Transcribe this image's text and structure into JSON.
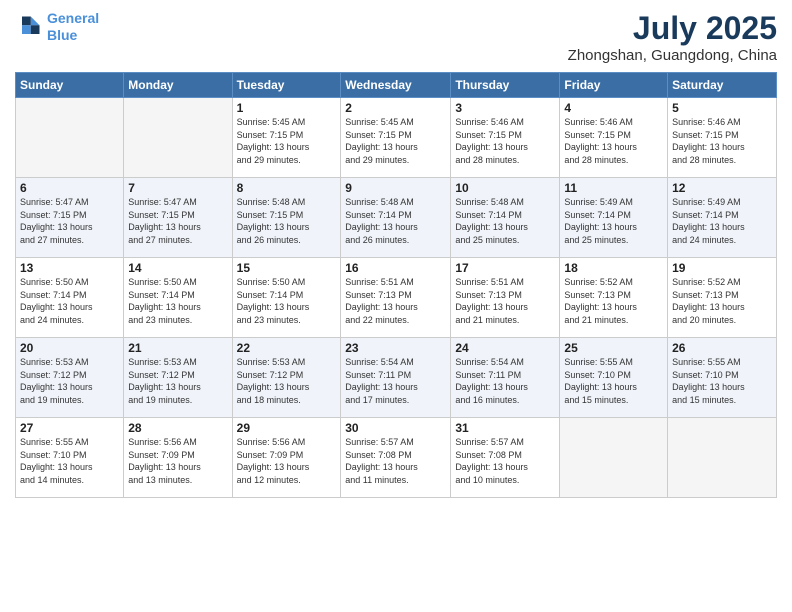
{
  "header": {
    "logo_line1": "General",
    "logo_line2": "Blue",
    "title": "July 2025",
    "subtitle": "Zhongshan, Guangdong, China"
  },
  "days_of_week": [
    "Sunday",
    "Monday",
    "Tuesday",
    "Wednesday",
    "Thursday",
    "Friday",
    "Saturday"
  ],
  "weeks": [
    [
      {
        "day": "",
        "info": ""
      },
      {
        "day": "",
        "info": ""
      },
      {
        "day": "1",
        "info": "Sunrise: 5:45 AM\nSunset: 7:15 PM\nDaylight: 13 hours\nand 29 minutes."
      },
      {
        "day": "2",
        "info": "Sunrise: 5:45 AM\nSunset: 7:15 PM\nDaylight: 13 hours\nand 29 minutes."
      },
      {
        "day": "3",
        "info": "Sunrise: 5:46 AM\nSunset: 7:15 PM\nDaylight: 13 hours\nand 28 minutes."
      },
      {
        "day": "4",
        "info": "Sunrise: 5:46 AM\nSunset: 7:15 PM\nDaylight: 13 hours\nand 28 minutes."
      },
      {
        "day": "5",
        "info": "Sunrise: 5:46 AM\nSunset: 7:15 PM\nDaylight: 13 hours\nand 28 minutes."
      }
    ],
    [
      {
        "day": "6",
        "info": "Sunrise: 5:47 AM\nSunset: 7:15 PM\nDaylight: 13 hours\nand 27 minutes."
      },
      {
        "day": "7",
        "info": "Sunrise: 5:47 AM\nSunset: 7:15 PM\nDaylight: 13 hours\nand 27 minutes."
      },
      {
        "day": "8",
        "info": "Sunrise: 5:48 AM\nSunset: 7:15 PM\nDaylight: 13 hours\nand 26 minutes."
      },
      {
        "day": "9",
        "info": "Sunrise: 5:48 AM\nSunset: 7:14 PM\nDaylight: 13 hours\nand 26 minutes."
      },
      {
        "day": "10",
        "info": "Sunrise: 5:48 AM\nSunset: 7:14 PM\nDaylight: 13 hours\nand 25 minutes."
      },
      {
        "day": "11",
        "info": "Sunrise: 5:49 AM\nSunset: 7:14 PM\nDaylight: 13 hours\nand 25 minutes."
      },
      {
        "day": "12",
        "info": "Sunrise: 5:49 AM\nSunset: 7:14 PM\nDaylight: 13 hours\nand 24 minutes."
      }
    ],
    [
      {
        "day": "13",
        "info": "Sunrise: 5:50 AM\nSunset: 7:14 PM\nDaylight: 13 hours\nand 24 minutes."
      },
      {
        "day": "14",
        "info": "Sunrise: 5:50 AM\nSunset: 7:14 PM\nDaylight: 13 hours\nand 23 minutes."
      },
      {
        "day": "15",
        "info": "Sunrise: 5:50 AM\nSunset: 7:14 PM\nDaylight: 13 hours\nand 23 minutes."
      },
      {
        "day": "16",
        "info": "Sunrise: 5:51 AM\nSunset: 7:13 PM\nDaylight: 13 hours\nand 22 minutes."
      },
      {
        "day": "17",
        "info": "Sunrise: 5:51 AM\nSunset: 7:13 PM\nDaylight: 13 hours\nand 21 minutes."
      },
      {
        "day": "18",
        "info": "Sunrise: 5:52 AM\nSunset: 7:13 PM\nDaylight: 13 hours\nand 21 minutes."
      },
      {
        "day": "19",
        "info": "Sunrise: 5:52 AM\nSunset: 7:13 PM\nDaylight: 13 hours\nand 20 minutes."
      }
    ],
    [
      {
        "day": "20",
        "info": "Sunrise: 5:53 AM\nSunset: 7:12 PM\nDaylight: 13 hours\nand 19 minutes."
      },
      {
        "day": "21",
        "info": "Sunrise: 5:53 AM\nSunset: 7:12 PM\nDaylight: 13 hours\nand 19 minutes."
      },
      {
        "day": "22",
        "info": "Sunrise: 5:53 AM\nSunset: 7:12 PM\nDaylight: 13 hours\nand 18 minutes."
      },
      {
        "day": "23",
        "info": "Sunrise: 5:54 AM\nSunset: 7:11 PM\nDaylight: 13 hours\nand 17 minutes."
      },
      {
        "day": "24",
        "info": "Sunrise: 5:54 AM\nSunset: 7:11 PM\nDaylight: 13 hours\nand 16 minutes."
      },
      {
        "day": "25",
        "info": "Sunrise: 5:55 AM\nSunset: 7:10 PM\nDaylight: 13 hours\nand 15 minutes."
      },
      {
        "day": "26",
        "info": "Sunrise: 5:55 AM\nSunset: 7:10 PM\nDaylight: 13 hours\nand 15 minutes."
      }
    ],
    [
      {
        "day": "27",
        "info": "Sunrise: 5:55 AM\nSunset: 7:10 PM\nDaylight: 13 hours\nand 14 minutes."
      },
      {
        "day": "28",
        "info": "Sunrise: 5:56 AM\nSunset: 7:09 PM\nDaylight: 13 hours\nand 13 minutes."
      },
      {
        "day": "29",
        "info": "Sunrise: 5:56 AM\nSunset: 7:09 PM\nDaylight: 13 hours\nand 12 minutes."
      },
      {
        "day": "30",
        "info": "Sunrise: 5:57 AM\nSunset: 7:08 PM\nDaylight: 13 hours\nand 11 minutes."
      },
      {
        "day": "31",
        "info": "Sunrise: 5:57 AM\nSunset: 7:08 PM\nDaylight: 13 hours\nand 10 minutes."
      },
      {
        "day": "",
        "info": ""
      },
      {
        "day": "",
        "info": ""
      }
    ]
  ]
}
